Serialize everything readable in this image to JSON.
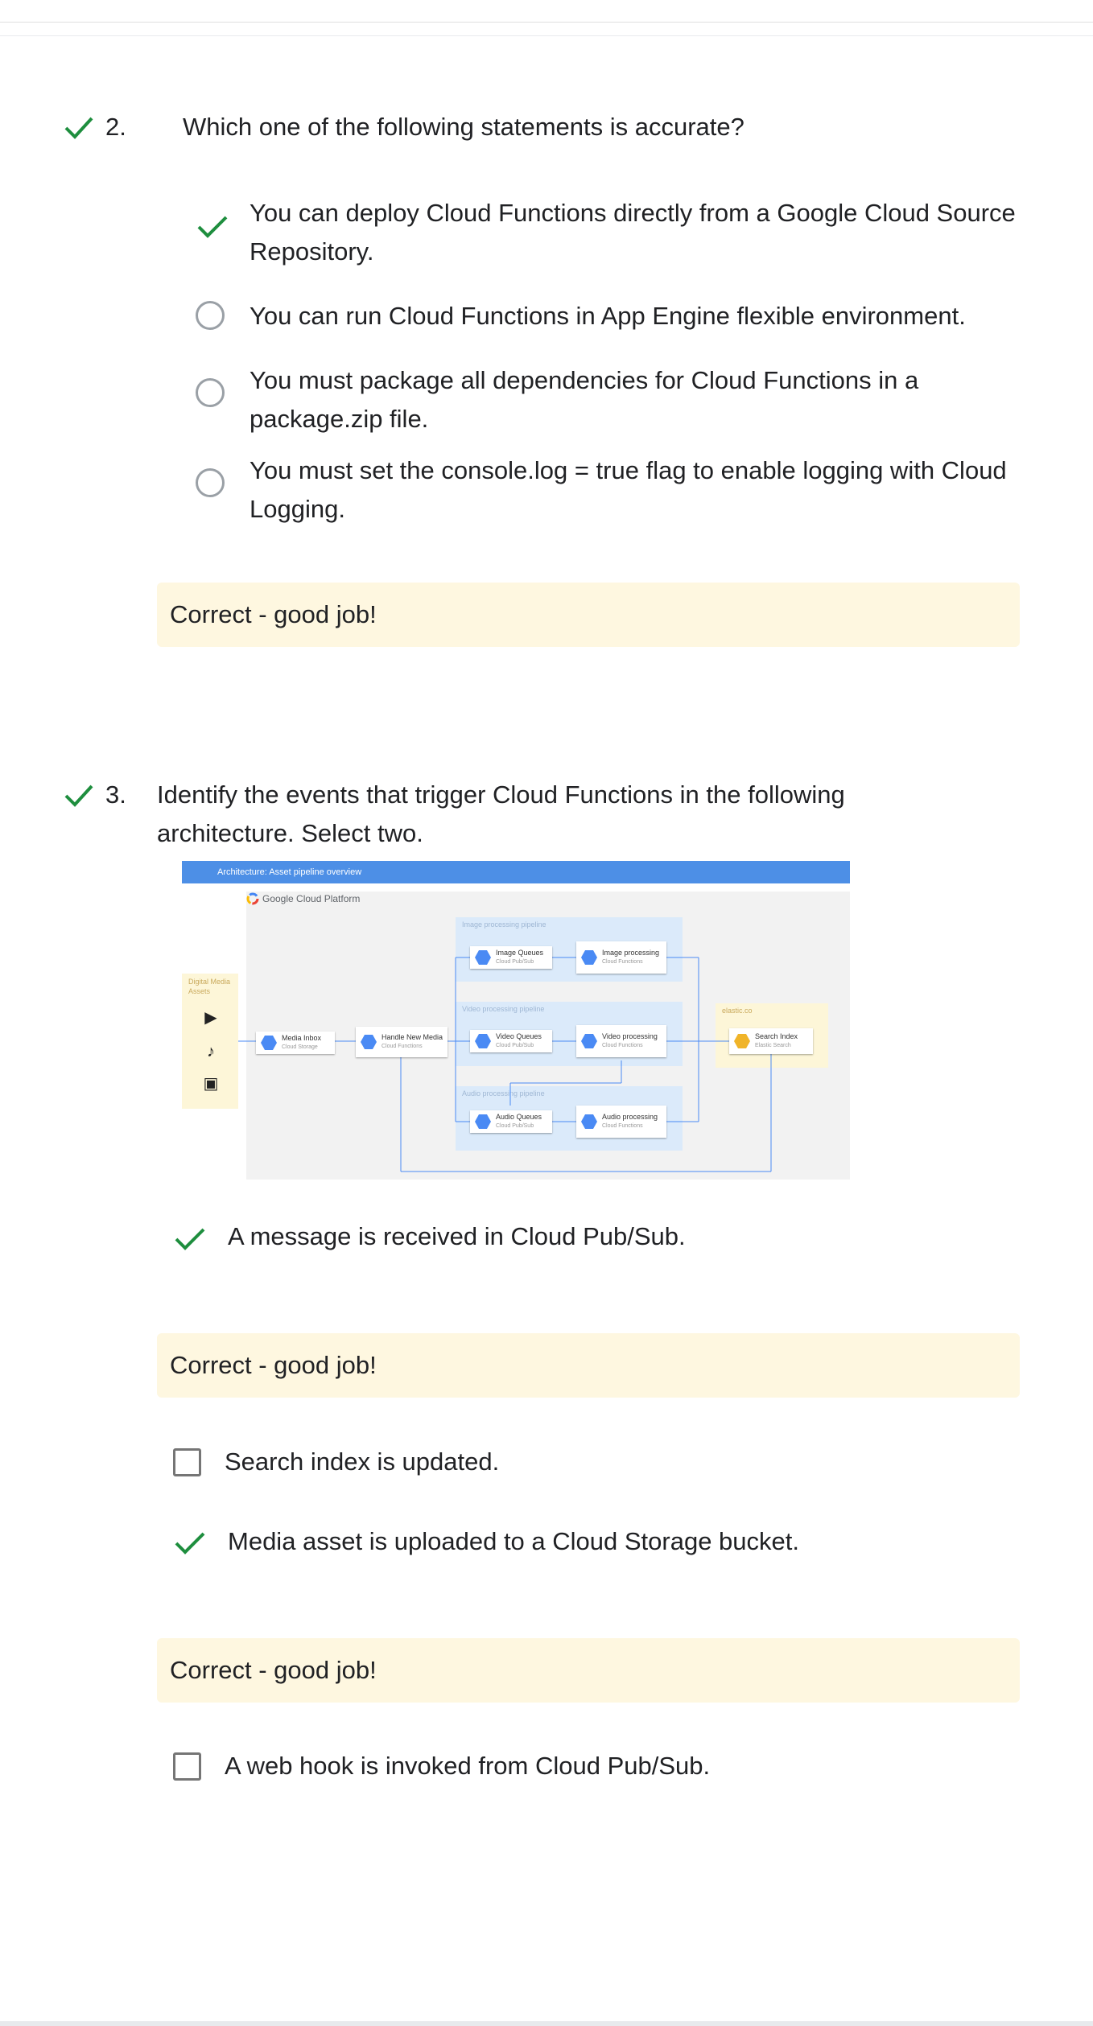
{
  "questions": [
    {
      "number": "2.",
      "text": "Which one of the following statements is accurate?",
      "options": [
        {
          "text": "You can deploy Cloud Functions directly from a Google Cloud Source Repository.",
          "selected": true
        },
        {
          "text": "You can run Cloud Functions in App Engine flexible environment.",
          "selected": false
        },
        {
          "text": "You must package all dependencies for Cloud Functions in a package.zip file.",
          "selected": false
        },
        {
          "text": "You must set the console.log = true flag to enable logging with Cloud Logging.",
          "selected": false
        }
      ],
      "feedback": "Correct - good job!"
    },
    {
      "number": "3.",
      "text": "Identify the events that trigger Cloud Functions in the following architecture. Select two.",
      "options": [
        {
          "text": "A message is received in Cloud Pub/Sub.",
          "selected": true,
          "feedback": "Correct - good job!"
        },
        {
          "text": "Search index is updated.",
          "selected": false
        },
        {
          "text": "Media asset is uploaded to a Cloud Storage bucket.",
          "selected": true,
          "feedback": "Correct - good job!"
        },
        {
          "text": "A web hook is invoked from Cloud Pub/Sub.",
          "selected": false
        }
      ]
    }
  ],
  "diagram": {
    "banner": "Architecture: Asset pipeline overview",
    "platform": "Google Cloud Platform",
    "assets_label": "Digital Media Assets",
    "pipelines": {
      "image": "Image processing pipeline",
      "video": "Video processing pipeline",
      "audio": "Audio processing pipeline"
    },
    "elastic_label": "elastic.co",
    "nodes": {
      "media_inbox": {
        "title": "Media Inbox",
        "sub": "Cloud Storage"
      },
      "handle_media": {
        "title": "Handle New Media",
        "sub": "Cloud Functions"
      },
      "image_queues": {
        "title": "Image Queues",
        "sub": "Cloud Pub/Sub"
      },
      "image_processing": {
        "title": "Image processing",
        "sub": "Cloud Functions"
      },
      "video_queues": {
        "title": "Video Queues",
        "sub": "Cloud Pub/Sub"
      },
      "video_processing": {
        "title": "Video processing",
        "sub": "Cloud Functions"
      },
      "audio_queues": {
        "title": "Audio Queues",
        "sub": "Cloud Pub/Sub"
      },
      "audio_processing": {
        "title": "Audio processing",
        "sub": "Cloud Functions"
      },
      "search_index": {
        "title": "Search Index",
        "sub": "Elastic Search"
      }
    }
  },
  "colors": {
    "check": "#1e8e3e",
    "feedback_bg": "#fef7e0",
    "radio_border": "#9aa0a6",
    "banner": "#4d8fe6"
  }
}
